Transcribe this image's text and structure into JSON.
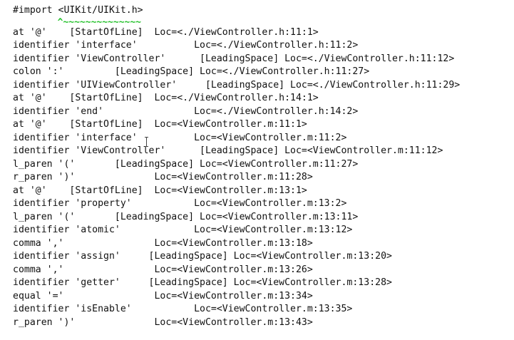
{
  "terminal": {
    "lines": [
      {
        "text": "#import <UIKit/UIKit.h>",
        "kind": "normal"
      },
      {
        "text": "        ^~~~~~~~~~~~~~~",
        "kind": "caret"
      },
      {
        "text": "at '@'    [StartOfLine]  Loc=<./ViewController.h:11:1>",
        "kind": "normal"
      },
      {
        "text": "identifier 'interface'          Loc=<./ViewController.h:11:2>",
        "kind": "normal"
      },
      {
        "text": "identifier 'ViewController'      [LeadingSpace] Loc=<./ViewController.h:11:12>",
        "kind": "normal"
      },
      {
        "text": "colon ':'         [LeadingSpace] Loc=<./ViewController.h:11:27>",
        "kind": "normal"
      },
      {
        "text": "identifier 'UIViewController'     [LeadingSpace] Loc=<./ViewController.h:11:29>",
        "kind": "normal"
      },
      {
        "text": "at '@'    [StartOfLine]  Loc=<./ViewController.h:14:1>",
        "kind": "normal"
      },
      {
        "text": "identifier 'end'                Loc=<./ViewController.h:14:2>",
        "kind": "normal"
      },
      {
        "text": "at '@'    [StartOfLine]  Loc=<ViewController.m:11:1>",
        "kind": "normal"
      },
      {
        "text": "identifier 'interface'          Loc=<ViewController.m:11:2>",
        "kind": "normal"
      },
      {
        "text": "identifier 'ViewController'      [LeadingSpace] Loc=<ViewController.m:11:12>",
        "kind": "normal"
      },
      {
        "text": "l_paren '('       [LeadingSpace] Loc=<ViewController.m:11:27>",
        "kind": "normal"
      },
      {
        "text": "r_paren ')'              Loc=<ViewController.m:11:28>",
        "kind": "normal"
      },
      {
        "text": "at '@'    [StartOfLine]  Loc=<ViewController.m:13:1>",
        "kind": "normal"
      },
      {
        "text": "identifier 'property'           Loc=<ViewController.m:13:2>",
        "kind": "normal"
      },
      {
        "text": "l_paren '('       [LeadingSpace] Loc=<ViewController.m:13:11>",
        "kind": "normal"
      },
      {
        "text": "identifier 'atomic'             Loc=<ViewController.m:13:12>",
        "kind": "normal"
      },
      {
        "text": "comma ','                Loc=<ViewController.m:13:18>",
        "kind": "normal"
      },
      {
        "text": "identifier 'assign'     [LeadingSpace] Loc=<ViewController.m:13:20>",
        "kind": "normal"
      },
      {
        "text": "comma ','                Loc=<ViewController.m:13:26>",
        "kind": "normal"
      },
      {
        "text": "identifier 'getter'     [LeadingSpace] Loc=<ViewController.m:13:28>",
        "kind": "normal"
      },
      {
        "text": "equal '='                Loc=<ViewController.m:13:34>",
        "kind": "normal"
      },
      {
        "text": "identifier 'isEnable'           Loc=<ViewController.m:13:35>",
        "kind": "normal"
      },
      {
        "text": "r_paren ')'              Loc=<ViewController.m:13:43>",
        "kind": "normal"
      }
    ],
    "caret_color": "#27c22e",
    "text_color": "#111111",
    "background_color": "#ffffff",
    "cursor_icon": "text-cursor-icon"
  }
}
